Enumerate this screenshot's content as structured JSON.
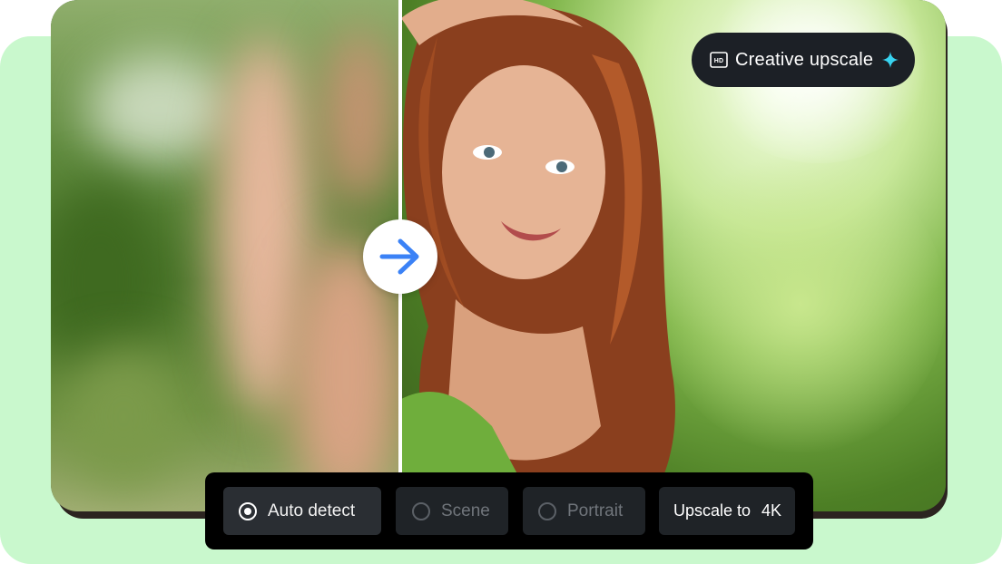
{
  "colors": {
    "backdrop": "#c9f8cd",
    "toolbar_bg": "#000000",
    "option_bg": "#1f2327",
    "badge_bg": "#1c2026",
    "arrow": "#3b82f6",
    "sparkle": "#38d3f0"
  },
  "badge": {
    "icon": "hd-icon",
    "label": "Creative upscale",
    "sparkle_icon": "sparkle-icon"
  },
  "comparison": {
    "arrow_icon": "arrow-right-icon"
  },
  "toolbar": {
    "options": [
      {
        "label": "Auto detect",
        "selected": true
      },
      {
        "label": "Scene",
        "selected": false
      },
      {
        "label": "Portrait",
        "selected": false
      }
    ],
    "upscale": {
      "label": "Upscale to",
      "value": "4K"
    }
  }
}
